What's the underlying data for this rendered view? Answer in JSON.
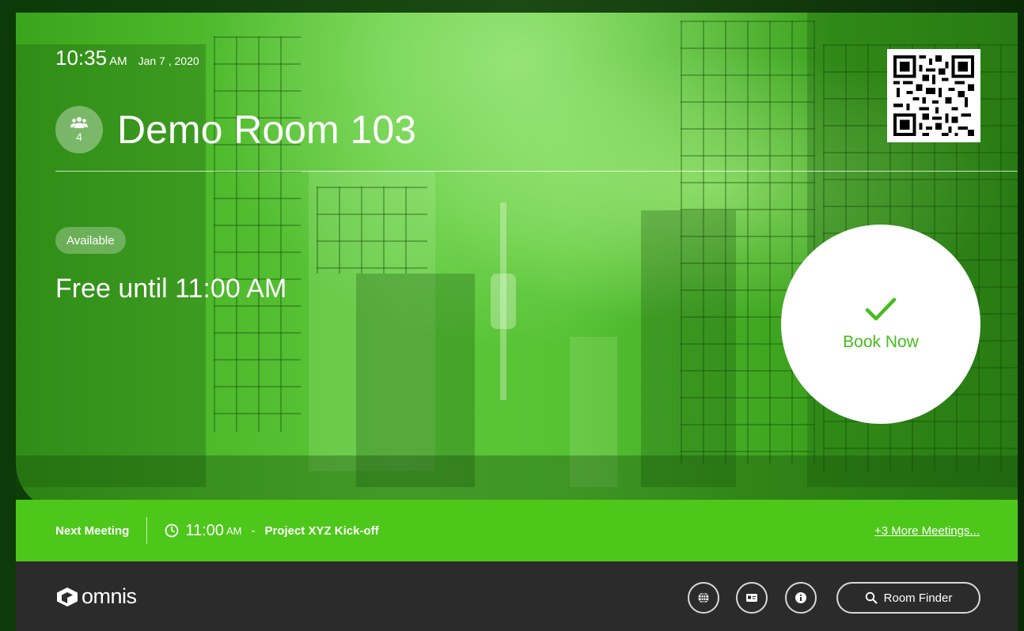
{
  "header": {
    "time": "10:35",
    "ampm": "AM",
    "date": "Jan 7 , 2020"
  },
  "room": {
    "capacity": "4",
    "name": "Demo Room 103"
  },
  "status": {
    "badge": "Available",
    "free_text": "Free until 11:00 AM"
  },
  "book_button": {
    "label": "Book Now"
  },
  "next_meeting": {
    "label": "Next Meeting",
    "time": "11:00",
    "ampm": "AM",
    "separator": "-",
    "title": "Project XYZ Kick-off",
    "more_link": "+3 More Meetings..."
  },
  "footer": {
    "logo_text": "omnis",
    "room_finder_label": "Room Finder",
    "icons": [
      "globe-icon",
      "id-card-icon",
      "info-icon",
      "search-icon"
    ]
  },
  "colors": {
    "accent_green": "#4dc71a",
    "book_text_green": "#44bd1d",
    "footer_bg": "#2b2b2b"
  }
}
